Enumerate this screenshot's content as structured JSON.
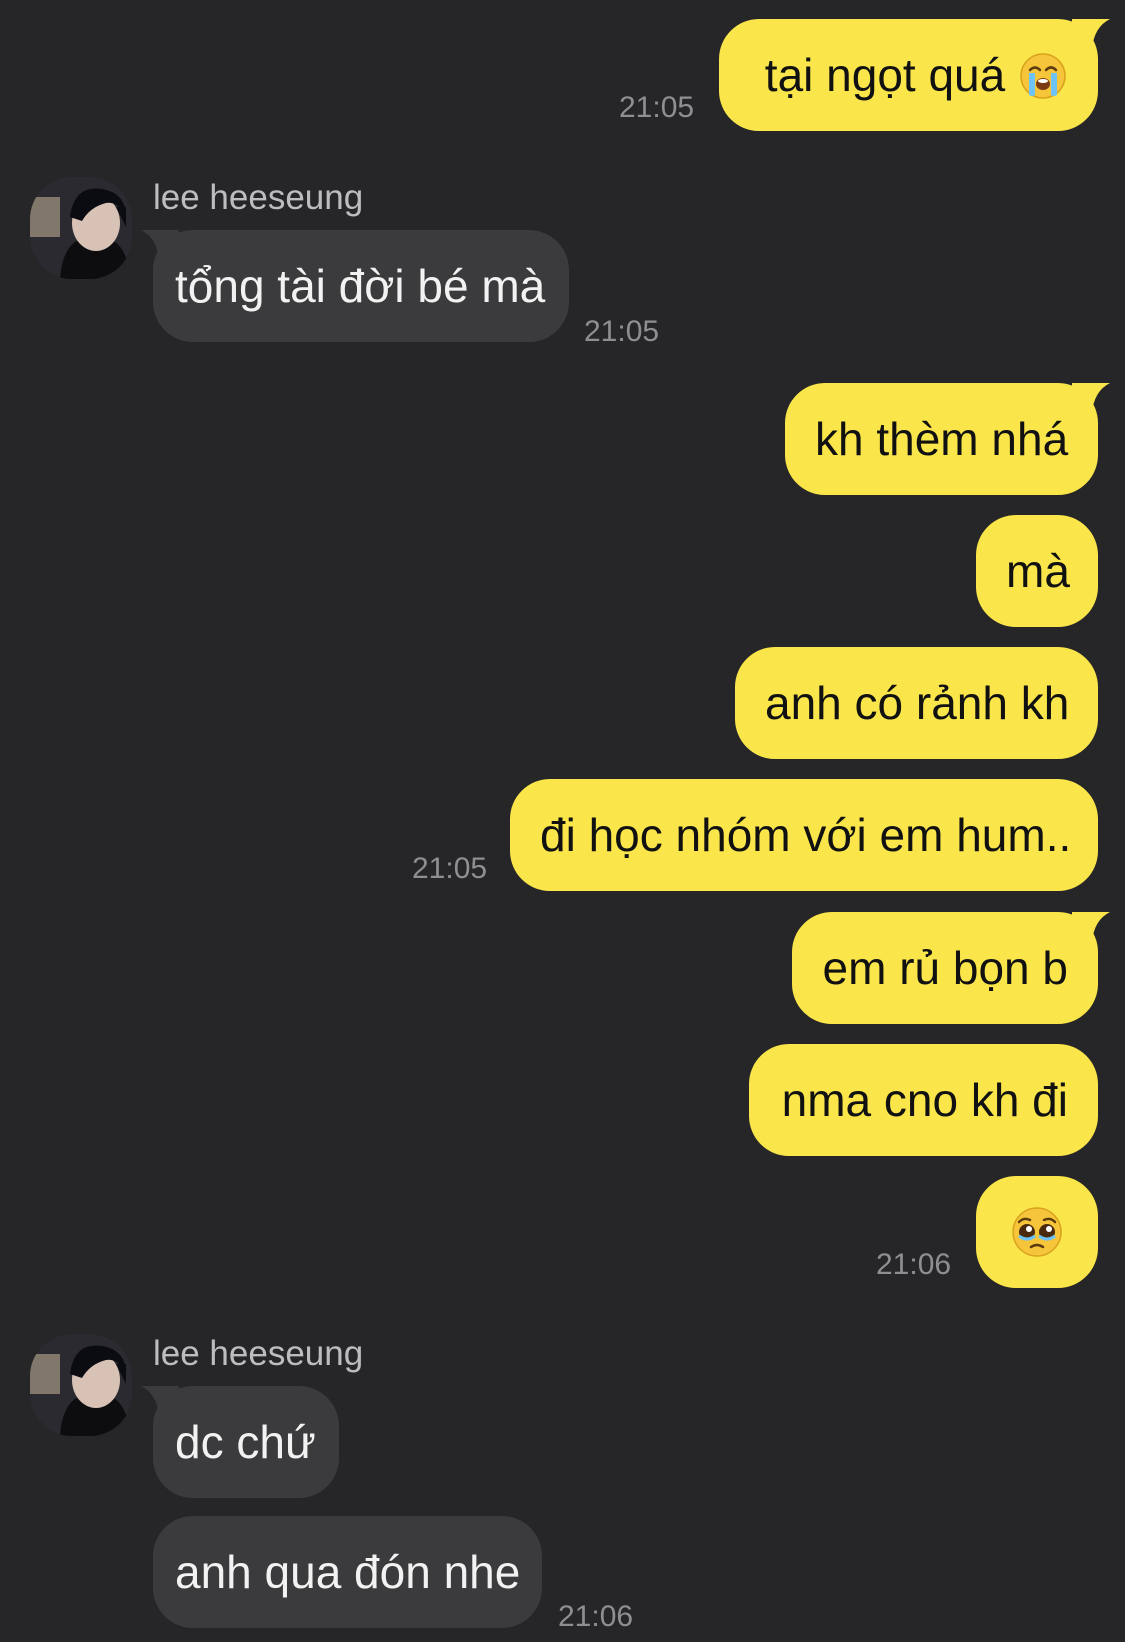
{
  "conversation": {
    "contact_name": "lee heeseung",
    "messages": [
      {
        "id": "m1",
        "sender": "me",
        "text": "tại ngọt quá",
        "emoji": "loudly-crying-face",
        "time": "21:05"
      },
      {
        "id": "m2",
        "sender": "lee heeseung",
        "text": "tổng tài đời bé mà",
        "time": "21:05"
      },
      {
        "id": "m3",
        "sender": "me",
        "text": "kh thèm nhá"
      },
      {
        "id": "m4",
        "sender": "me",
        "text": "mà"
      },
      {
        "id": "m5",
        "sender": "me",
        "text": "anh có rảnh kh"
      },
      {
        "id": "m6",
        "sender": "me",
        "text": "đi học nhóm với em hum..",
        "time": "21:05"
      },
      {
        "id": "m7",
        "sender": "me",
        "text": "em rủ bọn b"
      },
      {
        "id": "m8",
        "sender": "me",
        "text": "nma cno kh đi"
      },
      {
        "id": "m9",
        "sender": "me",
        "emoji": "pleading-face",
        "time": "21:06"
      },
      {
        "id": "m10",
        "sender": "lee heeseung",
        "text": "dc chứ"
      },
      {
        "id": "m11",
        "sender": "lee heeseung",
        "text": "anh qua đón nhe",
        "time": "21:06"
      }
    ]
  },
  "labels": {
    "m1": "tại ngọt quá",
    "m1_time": "21:05",
    "sender1": "lee heeseung",
    "m2": "tổng tài đời bé mà",
    "m2_time": "21:05",
    "m3": "kh thèm nhá",
    "m4": "mà",
    "m5": "anh có rảnh kh",
    "m6": "đi học nhóm với em hum..",
    "m6_time": "21:05",
    "m7": "em rủ bọn b",
    "m8": "nma cno kh đi",
    "m9_time": "21:06",
    "sender2": "lee heeseung",
    "m10": "dc chứ",
    "m11": "anh qua đón nhe",
    "m11_time": "21:06"
  },
  "colors": {
    "background": "#262628",
    "outgoing_bubble": "#FAE64A",
    "incoming_bubble": "#3B3B3D",
    "timestamp": "#8E8E93",
    "sender_name": "#BDBDC0"
  },
  "icons": {
    "m1_emoji": "loudly-crying-face",
    "m9_emoji": "pleading-face"
  }
}
